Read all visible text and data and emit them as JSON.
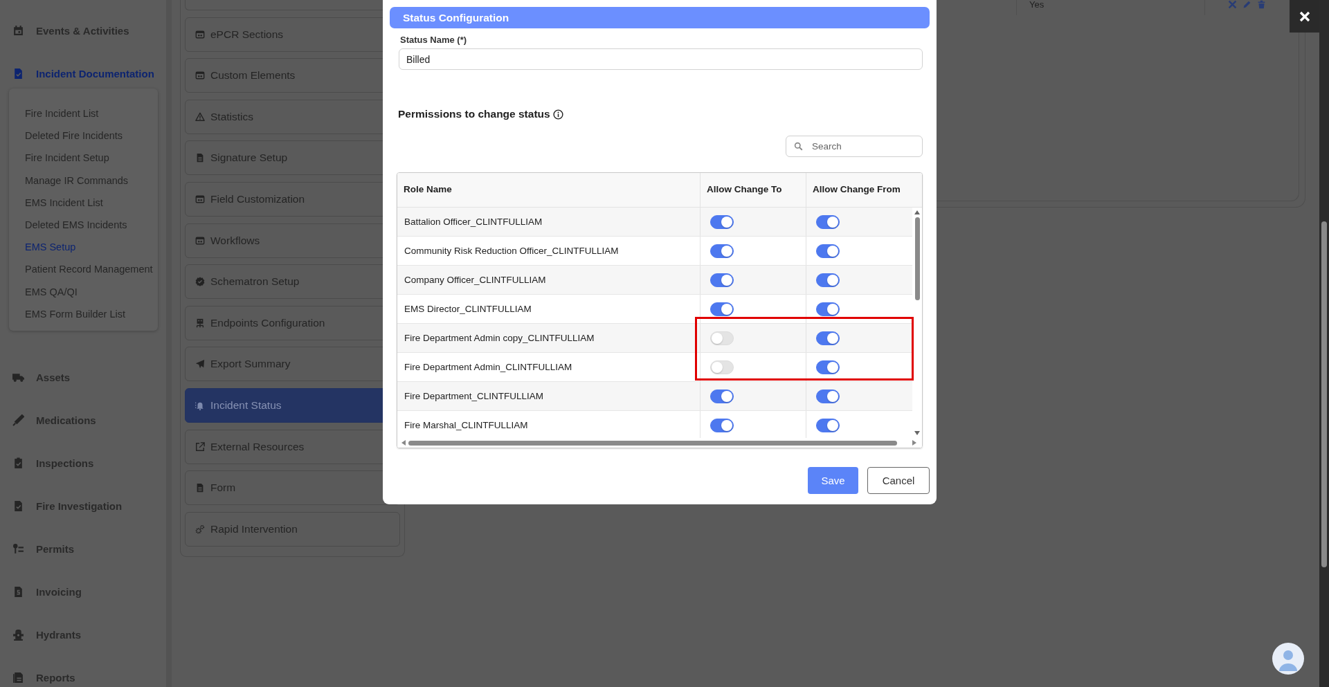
{
  "sidebar": {
    "items": [
      {
        "label": "Events & Activities",
        "selected": false
      },
      {
        "label": "Incident Documentation",
        "selected": true,
        "expanded": true,
        "children": [
          {
            "label": "Fire Incident List",
            "selected": false
          },
          {
            "label": "Deleted Fire Incidents",
            "selected": false
          },
          {
            "label": "Fire Incident Setup",
            "selected": false
          },
          {
            "label": "Manage IR Commands",
            "selected": false
          },
          {
            "label": "EMS Incident List",
            "selected": false
          },
          {
            "label": "Deleted EMS Incidents",
            "selected": false
          },
          {
            "label": "EMS Setup",
            "selected": true
          },
          {
            "label": "Patient Record Management",
            "selected": false
          },
          {
            "label": "EMS QA/QI",
            "selected": false
          },
          {
            "label": "EMS Form Builder List",
            "selected": false
          }
        ]
      },
      {
        "label": "Assets",
        "selected": false
      },
      {
        "label": "Medications",
        "selected": false
      },
      {
        "label": "Inspections",
        "selected": false
      },
      {
        "label": "Fire Investigation",
        "selected": false
      },
      {
        "label": "Permits",
        "selected": false
      },
      {
        "label": "Invoicing",
        "selected": false
      },
      {
        "label": "Hydrants",
        "selected": false
      },
      {
        "label": "Reports",
        "selected": false
      }
    ]
  },
  "settings_menu": {
    "items": [
      {
        "label": "ePCR Sections",
        "selected": false
      },
      {
        "label": "Custom Elements",
        "selected": false
      },
      {
        "label": "Statistics",
        "selected": false
      },
      {
        "label": "Signature Setup",
        "selected": false
      },
      {
        "label": "Field Customization",
        "selected": false
      },
      {
        "label": "Workflows",
        "selected": false
      },
      {
        "label": "Schematron Setup",
        "selected": false
      },
      {
        "label": "Endpoints Configuration",
        "selected": false
      },
      {
        "label": "Export Summary",
        "selected": false
      },
      {
        "label": "Incident Status",
        "selected": true
      },
      {
        "label": "External Resources",
        "selected": false
      },
      {
        "label": "Form",
        "selected": false
      },
      {
        "label": "Rapid Intervention",
        "selected": false
      }
    ]
  },
  "background_table": {
    "row": {
      "column_2": "Yes"
    }
  },
  "modal": {
    "title": "Status Configuration",
    "status_name": {
      "label": "Status Name (*)",
      "value": "Billed"
    },
    "permissions": {
      "heading": "Permissions to change status",
      "search": {
        "placeholder": "Search"
      },
      "columns": [
        "Role Name",
        "Allow Change To",
        "Allow Change From"
      ],
      "rows": [
        {
          "role": "Battalion Officer_CLINTFULLIAM",
          "allow_change_to": true,
          "allow_change_from": true,
          "highlighted": false
        },
        {
          "role": "Community Risk Reduction Officer_CLINTFULLIAM",
          "allow_change_to": true,
          "allow_change_from": true,
          "highlighted": false
        },
        {
          "role": "Company Officer_CLINTFULLIAM",
          "allow_change_to": true,
          "allow_change_from": true,
          "highlighted": false
        },
        {
          "role": "EMS Director_CLINTFULLIAM",
          "allow_change_to": true,
          "allow_change_from": true,
          "highlighted": false
        },
        {
          "role": "Fire Department Admin copy_CLINTFULLIAM",
          "allow_change_to": false,
          "allow_change_from": true,
          "highlighted": true
        },
        {
          "role": "Fire Department Admin_CLINTFULLIAM",
          "allow_change_to": false,
          "allow_change_from": true,
          "highlighted": true
        },
        {
          "role": "Fire Department_CLINTFULLIAM",
          "allow_change_to": true,
          "allow_change_from": true,
          "highlighted": false
        },
        {
          "role": "Fire Marshal_CLINTFULLIAM",
          "allow_change_to": true,
          "allow_change_from": true,
          "highlighted": false
        }
      ]
    },
    "buttons": {
      "save": "Save",
      "cancel": "Cancel"
    }
  }
}
